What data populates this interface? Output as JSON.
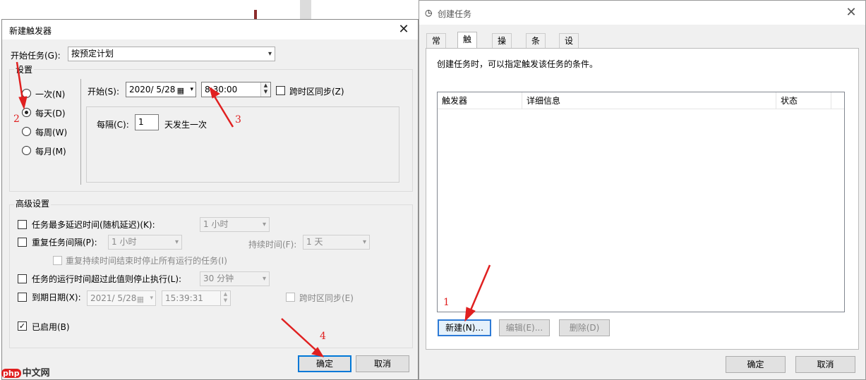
{
  "new_trigger": {
    "title": "新建触发器",
    "close": "✕",
    "begin_task_label": "开始任务(G):",
    "begin_task_value": "按预定计划",
    "settings_group": "设置",
    "schedule_options": [
      "一次(N)",
      "每天(D)",
      "每周(W)",
      "每月(M)"
    ],
    "selected_schedule": "每天(D)",
    "start_label": "开始(S):",
    "start_date": "2020/ 5/28",
    "start_time": "8:30:00",
    "sync_timezone": "跨时区同步(Z)",
    "every_label": "每隔(C):",
    "every_value": "1",
    "every_suffix": "天发生一次",
    "advanced_group": "高级设置",
    "delay_label": "任务最多延迟时间(随机延迟)(K):",
    "delay_value": "1 小时",
    "repeat_label": "重复任务间隔(P):",
    "repeat_value": "1 小时",
    "duration_label": "持续时间(F):",
    "duration_value": "1 天",
    "stop_repeat_label": "重复持续时间结束时停止所有运行的任务(I)",
    "stop_if_longer_label": "任务的运行时间超过此值则停止执行(L):",
    "stop_if_longer_value": "30 分钟",
    "expire_label": "到期日期(X):",
    "expire_date": "2021/ 5/28",
    "expire_time": "15:39:31",
    "expire_sync": "跨时区同步(E)",
    "enabled_label": "已启用(B)",
    "ok": "确定",
    "cancel": "取消"
  },
  "create_task": {
    "title": "创建任务",
    "close": "✕",
    "tabs": [
      "常规",
      "触发器",
      "操作",
      "条件",
      "设置"
    ],
    "active_tab": "触发器",
    "description": "创建任务时，可以指定触发该任务的条件。",
    "columns": [
      "触发器",
      "详细信息",
      "状态"
    ],
    "new_button": "新建(N)...",
    "edit_button": "编辑(E)...",
    "delete_button": "删除(D)",
    "ok": "确定",
    "cancel": "取消"
  },
  "annotations": [
    "1",
    "2",
    "3",
    "4"
  ],
  "colors": {
    "annotation": "#e02020",
    "focus": "#0078d7"
  },
  "watermark": {
    "badge": "php",
    "text": "中文网"
  }
}
